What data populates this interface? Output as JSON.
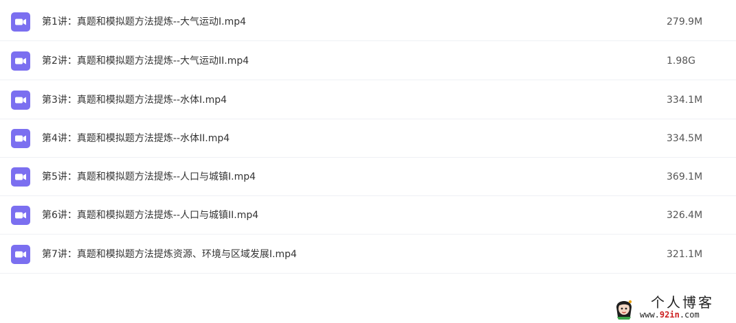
{
  "files": [
    {
      "name": "第1讲：真题和模拟题方法提炼--大气运动I.mp4",
      "size": "279.9M",
      "icon": "video-file-icon"
    },
    {
      "name": "第2讲：真题和模拟题方法提炼--大气运动II.mp4",
      "size": "1.98G",
      "icon": "video-file-icon"
    },
    {
      "name": "第3讲：真题和模拟题方法提炼--水体I.mp4",
      "size": "334.1M",
      "icon": "video-file-icon"
    },
    {
      "name": "第4讲：真题和模拟题方法提炼--水体II.mp4",
      "size": "334.5M",
      "icon": "video-file-icon"
    },
    {
      "name": "第5讲：真题和模拟题方法提炼--人口与城镇I.mp4",
      "size": "369.1M",
      "icon": "video-file-icon"
    },
    {
      "name": "第6讲：真题和模拟题方法提炼--人口与城镇II.mp4",
      "size": "326.4M",
      "icon": "video-file-icon"
    },
    {
      "name": "第7讲：真题和模拟题方法提炼资源、环境与区域发展I.mp4",
      "size": "321.1M",
      "icon": "video-file-icon"
    }
  ],
  "watermark": {
    "title": "个人博客",
    "url_prefix": "www.",
    "url_highlight": "92in",
    "url_suffix": ".com"
  },
  "colors": {
    "icon_accent": "#7b6ff0",
    "divider": "#eef0f4",
    "text": "#333333"
  }
}
